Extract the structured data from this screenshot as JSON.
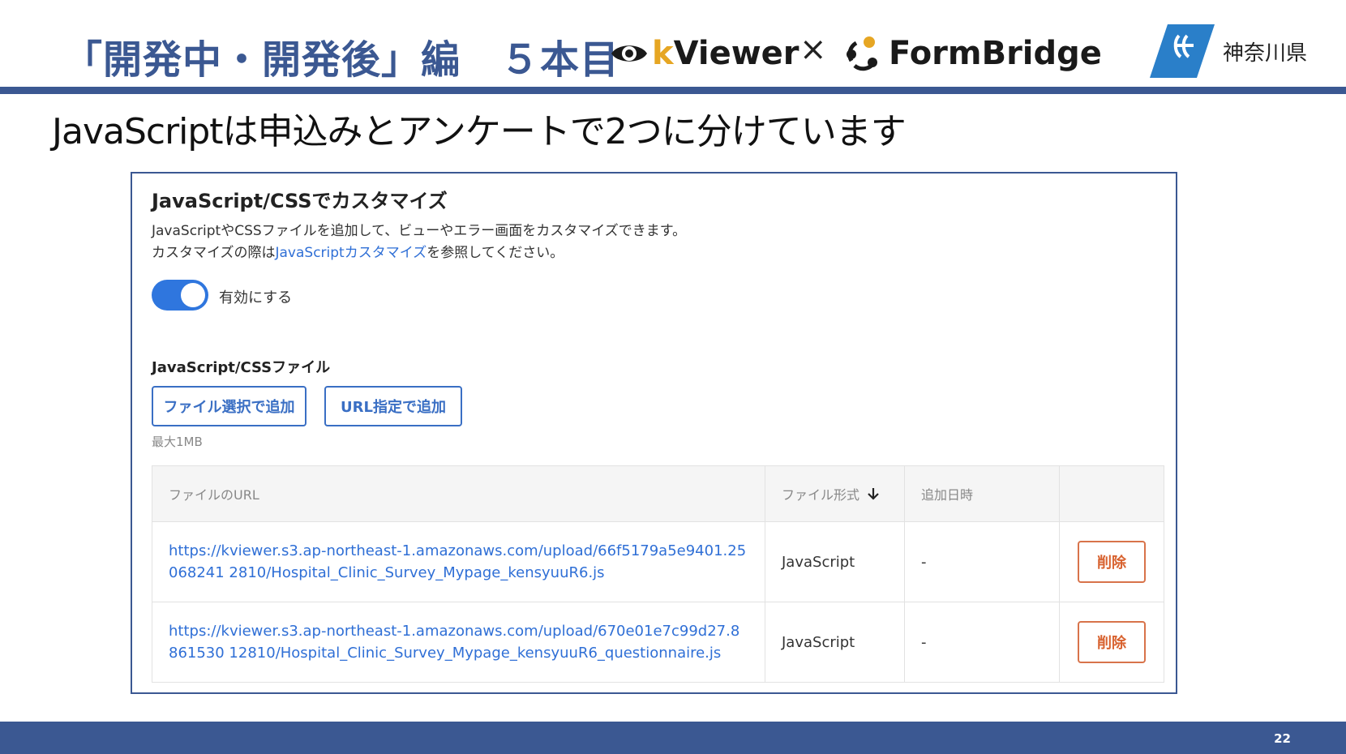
{
  "slide": {
    "title": "「開発中・開発後」編　５本目",
    "logo_kviewer": {
      "k": "k",
      "rest": "Viewer",
      "accent": "#e6a623"
    },
    "cross": "×",
    "logo_formbridge": "FormBridge",
    "prefecture": "神奈川県",
    "subtitle": "JavaScriptは申込みとアンケートで2つに分けています",
    "page_number": "22",
    "accent_color": "#3b5892"
  },
  "panel": {
    "heading": "JavaScript/CSSでカスタマイズ",
    "desc_line1": "JavaScriptやCSSファイルを追加して、ビューやエラー画面をカスタマイズできます。",
    "desc_line2_before": "カスタマイズの際は",
    "desc_line2_link": "JavaScriptカスタマイズ",
    "desc_line2_after": "を参照してください。",
    "toggle": {
      "label": "有効にする",
      "on": true
    },
    "files_heading": "JavaScript/CSSファイル",
    "add_file_button": "ファイル選択で追加",
    "add_url_button": "URL指定で追加",
    "size_note": "最大1MB",
    "table": {
      "headers": {
        "url": "ファイルのURL",
        "type": "ファイル形式",
        "date": "追加日時",
        "action": ""
      },
      "rows": [
        {
          "url": "https://kviewer.s3.ap-northeast-1.amazonaws.com/upload/66f5179a5e9401.25068241 2810/Hospital_Clinic_Survey_Mypage_kensyuuR6.js",
          "type": "JavaScript",
          "date": "-",
          "action": "削除"
        },
        {
          "url": "https://kviewer.s3.ap-northeast-1.amazonaws.com/upload/670e01e7c99d27.8861530 12810/Hospital_Clinic_Survey_Mypage_kensyuuR6_questionnaire.js",
          "type": "JavaScript",
          "date": "-",
          "action": "削除"
        }
      ]
    }
  }
}
